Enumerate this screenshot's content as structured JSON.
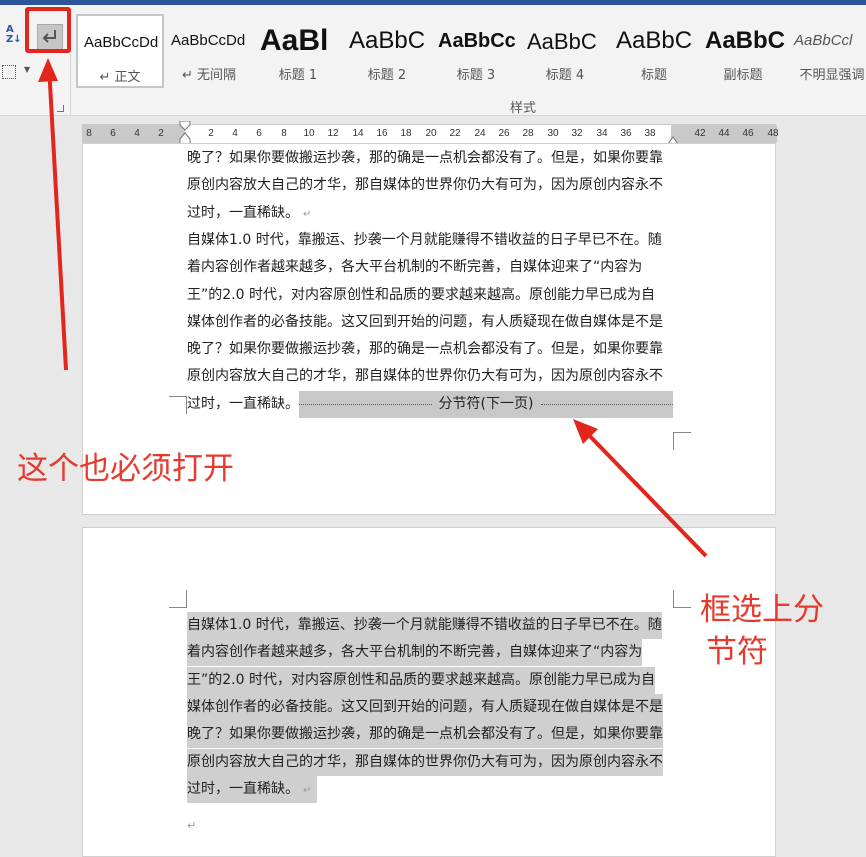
{
  "ribbon": {
    "sort_icon": "sort-az-icon",
    "show_marks_icon": "paragraph-marks-icon",
    "border_icon": "borders-icon",
    "styles": [
      {
        "sample": "AaBbCcDd",
        "name": "↵ 正文",
        "selected": true
      },
      {
        "sample": "AaBbCcDd",
        "name": "↵ 无间隔",
        "selected": false
      },
      {
        "sample": "AaBl",
        "name": "标题 1",
        "selected": false
      },
      {
        "sample": "AaBbC",
        "name": "标题 2",
        "selected": false
      },
      {
        "sample": "AaBbCc",
        "name": "标题 3",
        "selected": false
      },
      {
        "sample": "AaBbC",
        "name": "标题 4",
        "selected": false
      },
      {
        "sample": "AaBbC",
        "name": "标题",
        "selected": false
      },
      {
        "sample": "AaBbC",
        "name": "副标题",
        "selected": false
      },
      {
        "sample": "AaBbCcl",
        "name": "不明显强调",
        "selected": false
      }
    ],
    "styles_label": "样式"
  },
  "ruler": {
    "ticks": [
      "8",
      "6",
      "4",
      "2",
      "2",
      "4",
      "6",
      "8",
      "10",
      "12",
      "14",
      "16",
      "18",
      "20",
      "22",
      "24",
      "26",
      "28",
      "30",
      "32",
      "34",
      "36",
      "38",
      "42",
      "44",
      "46",
      "48"
    ]
  },
  "page1": {
    "lines": [
      "晚了？如果你要做搬运抄袭，那的确是一点机会都没有了。但是，如果你要靠",
      "原创内容放大自己的才华，那自媒体的世界你仍大有可为，因为原创内容永不",
      "过时，一直稀缺。",
      "自媒体1.0 时代，靠搬运、抄袭一个月就能赚得不错收益的日子早已不在。随",
      "着内容创作者越来越多，各大平台机制的不断完善，自媒体迎来了“内容为",
      "王”的2.0 时代，对内容原创性和品质的要求越来越高。原创能力早已成为自",
      "媒体创作者的必备技能。这又回到开始的问题，有人质疑现在做自媒体是不是",
      "晚了？如果你要做搬运抄袭，那的确是一点机会都没有了。但是，如果你要靠",
      "原创内容放大自己的才华，那自媒体的世界你仍大有可为，因为原创内容永不",
      "过时，一直稀缺。"
    ],
    "section_break": "分节符(下一页)"
  },
  "page2": {
    "lines": [
      "自媒体1.0 时代，靠搬运、抄袭一个月就能赚得不错收益的日子早已不在。随",
      "着内容创作者越来越多，各大平台机制的不断完善，自媒体迎来了“内容为",
      "王”的2.0 时代，对内容原创性和品质的要求越来越高。原创能力早已成为自",
      "媒体创作者的必备技能。这又回到开始的问题，有人质疑现在做自媒体是不是",
      "晚了？如果你要做搬运抄袭，那的确是一点机会都没有了。但是，如果你要靠",
      "原创内容放大自己的才华，那自媒体的世界你仍大有可为，因为原创内容永不",
      "过时，一直稀缺。"
    ]
  },
  "annotations": {
    "open_marks": "这个也必须打开",
    "select_break_line1": "框选上分",
    "select_break_line2": "节符",
    "color": "#e53a2d"
  },
  "paragraph_mark": "↵"
}
